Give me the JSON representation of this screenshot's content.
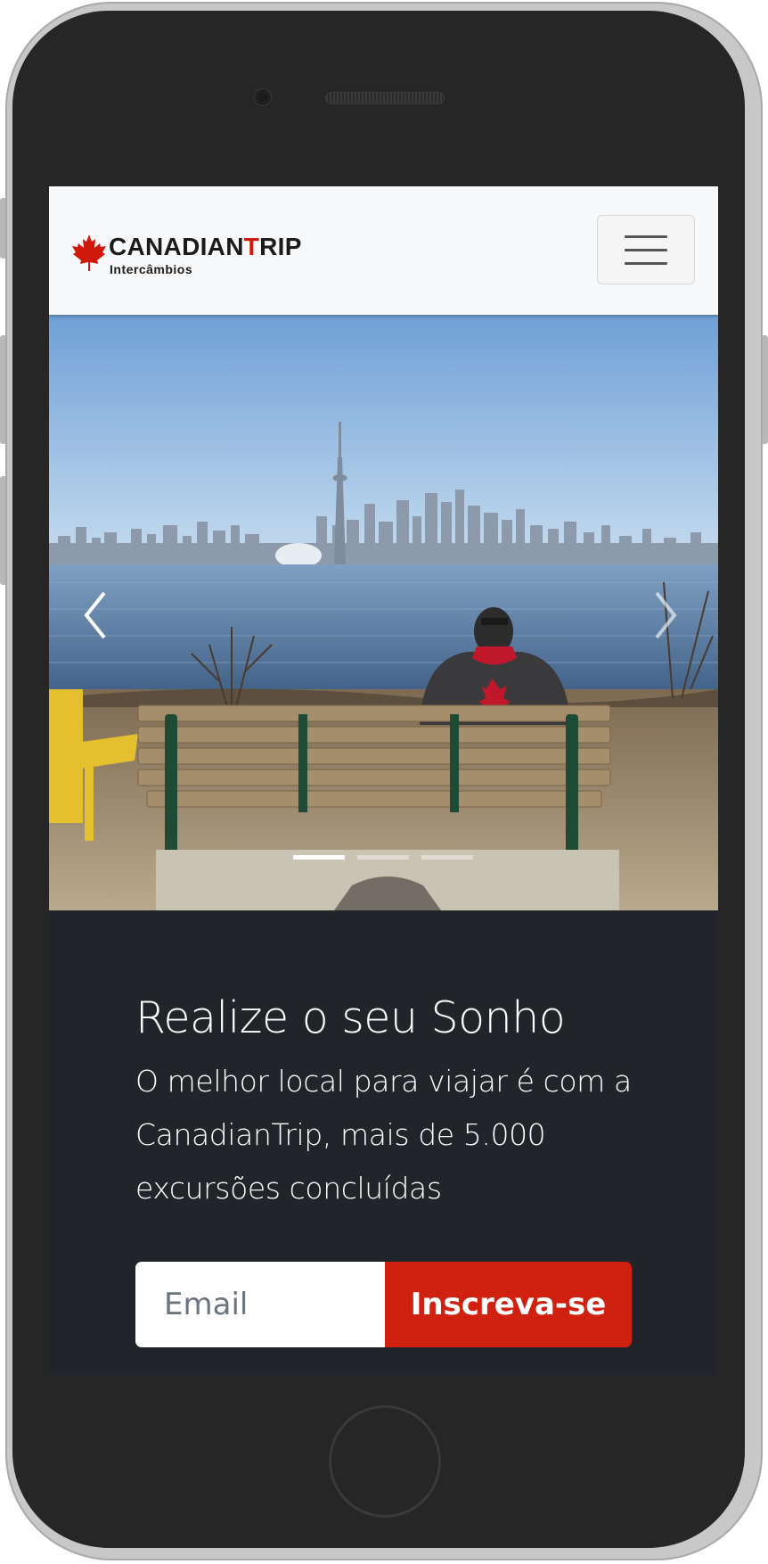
{
  "navbar": {
    "brand_part1": "CANADIAN",
    "brand_part2": "T",
    "brand_part3": "RIP",
    "brand_subtitle": "Intercâmbios",
    "brand_icon": "maple-leaf-icon",
    "menu_icon": "hamburger-menu-icon"
  },
  "carousel": {
    "prev_icon": "chevron-left-icon",
    "next_icon": "chevron-right-icon",
    "slide_count": 3,
    "active_slide": 1
  },
  "hero": {
    "title": "Realize o seu Sonho",
    "lead": "O melhor local para viajar é com a CanadianTrip, mais de 5.000 excursões concluídas"
  },
  "signup": {
    "email_placeholder": "Email",
    "button_label": "Inscreva-se"
  },
  "colors": {
    "brand_red": "#d0180b",
    "button_red": "#cf2010",
    "hero_background": "#212529",
    "navbar_background": "#f8f9fa"
  }
}
